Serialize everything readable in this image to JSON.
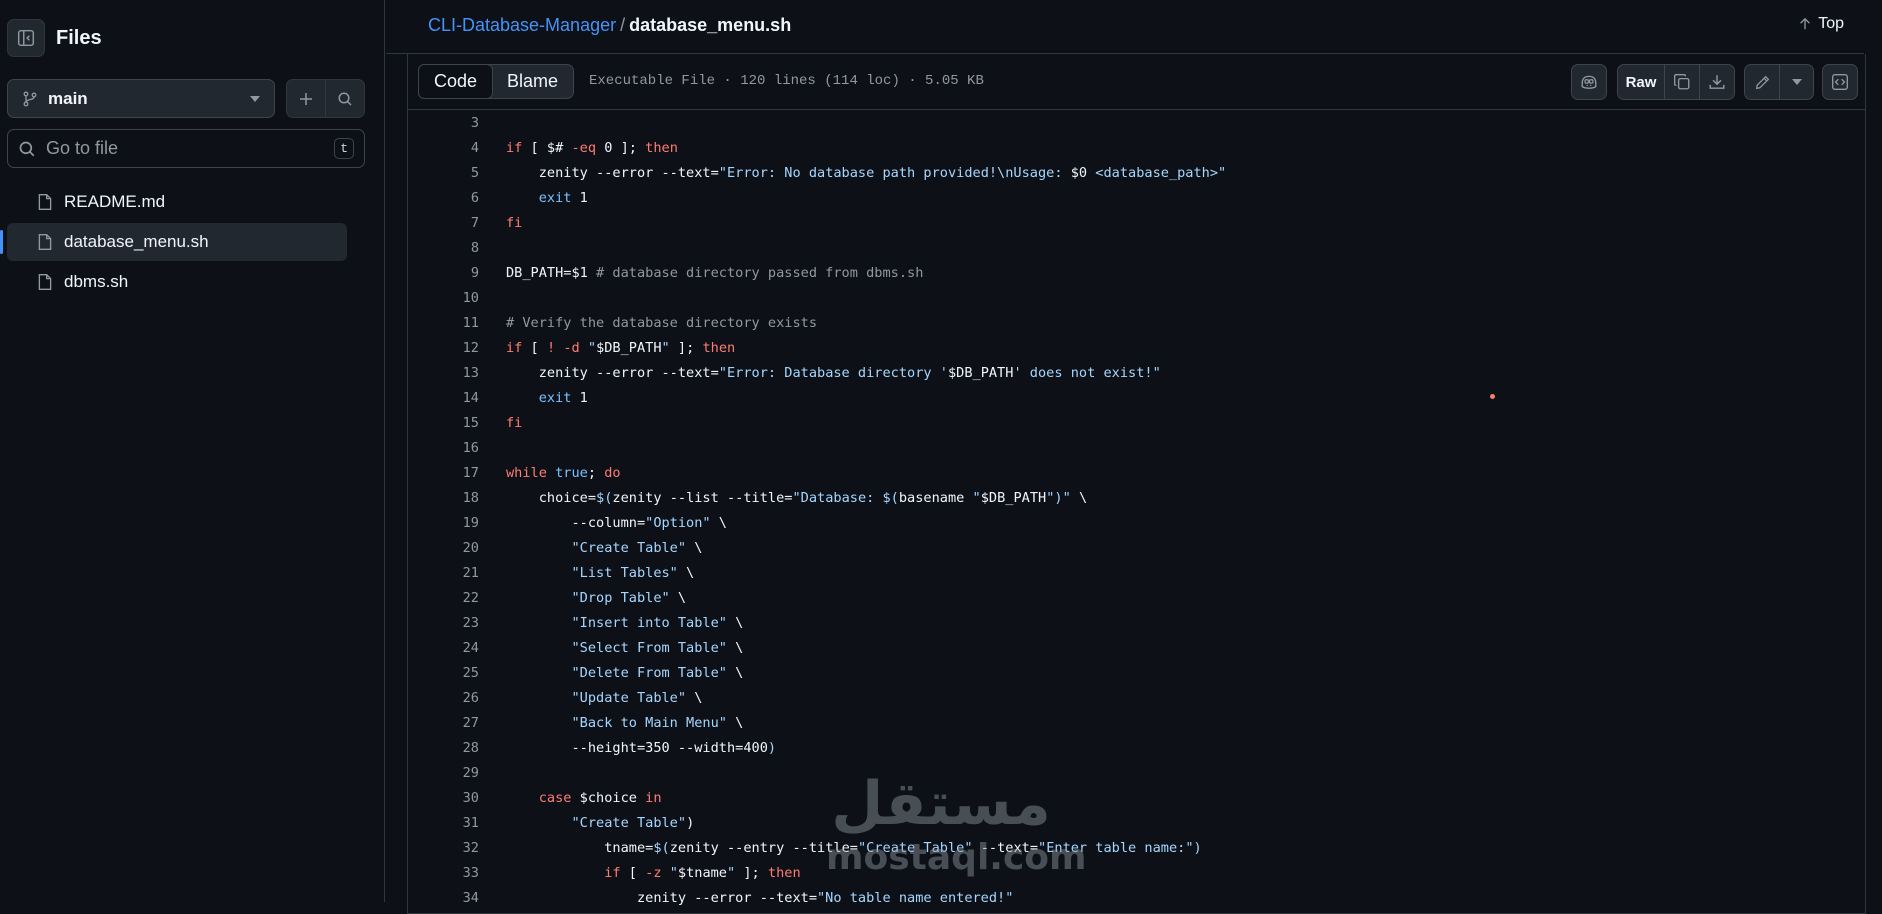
{
  "sidebar": {
    "title": "Files",
    "branch": "main",
    "search": {
      "placeholder": "Go to file",
      "shortcut": "t"
    },
    "items": [
      {
        "label": "README.md",
        "active": false
      },
      {
        "label": "database_menu.sh",
        "active": true
      },
      {
        "label": "dbms.sh",
        "active": false
      }
    ]
  },
  "header": {
    "repo": "CLI-Database-Manager",
    "separator": "/",
    "file": "database_menu.sh",
    "top_label": "Top"
  },
  "toolbar": {
    "tabs": [
      "Code",
      "Blame"
    ],
    "active_tab": "Code",
    "meta": "Executable File · 120 lines (114 loc) · 5.05 KB",
    "raw_label": "Raw"
  },
  "code_lines": [
    {
      "n": "3",
      "parts": []
    },
    {
      "n": "4",
      "parts": [
        [
          "kw",
          "if"
        ],
        [
          "var",
          " [ $# "
        ],
        [
          "kw",
          "-eq"
        ],
        [
          "var",
          " 0 ]; "
        ],
        [
          "kw",
          "then"
        ]
      ]
    },
    {
      "n": "5",
      "parts": [
        [
          "var",
          "    zenity --error --text="
        ],
        [
          "str",
          "\"Error: No database path provided!\\nUsage: "
        ],
        [
          "var",
          "$0"
        ],
        [
          "str",
          " <database_path>\""
        ]
      ]
    },
    {
      "n": "6",
      "parts": [
        [
          "op",
          "    exit"
        ],
        [
          "var",
          " 1"
        ]
      ]
    },
    {
      "n": "7",
      "parts": [
        [
          "kw",
          "fi"
        ]
      ]
    },
    {
      "n": "8",
      "parts": []
    },
    {
      "n": "9",
      "parts": [
        [
          "var",
          "DB_PATH=$1 "
        ],
        [
          "com",
          "# database directory passed from dbms.sh"
        ]
      ]
    },
    {
      "n": "10",
      "parts": []
    },
    {
      "n": "11",
      "parts": [
        [
          "com",
          "# Verify the database directory exists"
        ]
      ]
    },
    {
      "n": "12",
      "parts": [
        [
          "kw",
          "if"
        ],
        [
          "var",
          " [ "
        ],
        [
          "kw",
          "!"
        ],
        [
          "var",
          " "
        ],
        [
          "kw",
          "-d"
        ],
        [
          "var",
          " "
        ],
        [
          "str",
          "\""
        ],
        [
          "var",
          "$DB_PATH"
        ],
        [
          "str",
          "\""
        ],
        [
          "var",
          " ]; "
        ],
        [
          "kw",
          "then"
        ]
      ]
    },
    {
      "n": "13",
      "parts": [
        [
          "var",
          "    zenity --error --text="
        ],
        [
          "str",
          "\"Error: Database directory '"
        ],
        [
          "var",
          "$DB_PATH"
        ],
        [
          "str",
          "' does not exist!\""
        ]
      ]
    },
    {
      "n": "14",
      "parts": [
        [
          "op",
          "    exit"
        ],
        [
          "var",
          " 1"
        ]
      ]
    },
    {
      "n": "15",
      "parts": [
        [
          "kw",
          "fi"
        ]
      ]
    },
    {
      "n": "16",
      "parts": []
    },
    {
      "n": "17",
      "parts": [
        [
          "kw",
          "while"
        ],
        [
          "op",
          " true"
        ],
        [
          "var",
          "; "
        ],
        [
          "kw",
          "do"
        ]
      ]
    },
    {
      "n": "18",
      "parts": [
        [
          "var",
          "    choice="
        ],
        [
          "str",
          "$("
        ],
        [
          "var",
          "zenity --list --title="
        ],
        [
          "str",
          "\"Database: $("
        ],
        [
          "var",
          "basename "
        ],
        [
          "str",
          "\""
        ],
        [
          "var",
          "$DB_PATH"
        ],
        [
          "str",
          "\")\""
        ],
        [
          "var",
          " \\"
        ]
      ]
    },
    {
      "n": "19",
      "parts": [
        [
          "var",
          "        --column="
        ],
        [
          "str",
          "\"Option\""
        ],
        [
          "var",
          " \\"
        ]
      ]
    },
    {
      "n": "20",
      "parts": [
        [
          "str",
          "        \"Create Table\""
        ],
        [
          "var",
          " \\"
        ]
      ]
    },
    {
      "n": "21",
      "parts": [
        [
          "str",
          "        \"List Tables\""
        ],
        [
          "var",
          " \\"
        ]
      ]
    },
    {
      "n": "22",
      "parts": [
        [
          "str",
          "        \"Drop Table\""
        ],
        [
          "var",
          " \\"
        ]
      ]
    },
    {
      "n": "23",
      "parts": [
        [
          "str",
          "        \"Insert into Table\""
        ],
        [
          "var",
          " \\"
        ]
      ]
    },
    {
      "n": "24",
      "parts": [
        [
          "str",
          "        \"Select From Table\""
        ],
        [
          "var",
          " \\"
        ]
      ]
    },
    {
      "n": "25",
      "parts": [
        [
          "str",
          "        \"Delete From Table\""
        ],
        [
          "var",
          " \\"
        ]
      ]
    },
    {
      "n": "26",
      "parts": [
        [
          "str",
          "        \"Update Table\""
        ],
        [
          "var",
          " \\"
        ]
      ]
    },
    {
      "n": "27",
      "parts": [
        [
          "str",
          "        \"Back to Main Menu\""
        ],
        [
          "var",
          " \\"
        ]
      ]
    },
    {
      "n": "28",
      "parts": [
        [
          "var",
          "        --height=350 --width=400"
        ],
        [
          "str",
          ")"
        ]
      ]
    },
    {
      "n": "29",
      "parts": []
    },
    {
      "n": "30",
      "parts": [
        [
          "kw",
          "    case"
        ],
        [
          "var",
          " $choice "
        ],
        [
          "kw",
          "in"
        ]
      ]
    },
    {
      "n": "31",
      "parts": [
        [
          "str",
          "        \"Create Table\""
        ],
        [
          "var",
          ")"
        ]
      ]
    },
    {
      "n": "32",
      "parts": [
        [
          "var",
          "            tname="
        ],
        [
          "str",
          "$("
        ],
        [
          "var",
          "zenity --entry --title="
        ],
        [
          "str",
          "\"Create Table\""
        ],
        [
          "var",
          " --text="
        ],
        [
          "str",
          "\"Enter table name:\""
        ],
        [
          "str",
          ")"
        ]
      ]
    },
    {
      "n": "33",
      "parts": [
        [
          "kw",
          "            if"
        ],
        [
          "var",
          " [ "
        ],
        [
          "kw",
          "-z"
        ],
        [
          "var",
          " "
        ],
        [
          "str",
          "\""
        ],
        [
          "var",
          "$tname"
        ],
        [
          "str",
          "\""
        ],
        [
          "var",
          " ]; "
        ],
        [
          "kw",
          "then"
        ]
      ]
    },
    {
      "n": "34",
      "parts": [
        [
          "var",
          "                zenity --error --text="
        ],
        [
          "str",
          "\"No table name entered!\""
        ]
      ]
    }
  ],
  "watermark": {
    "arabic": "مستقل",
    "latin": "mostaql.com"
  }
}
